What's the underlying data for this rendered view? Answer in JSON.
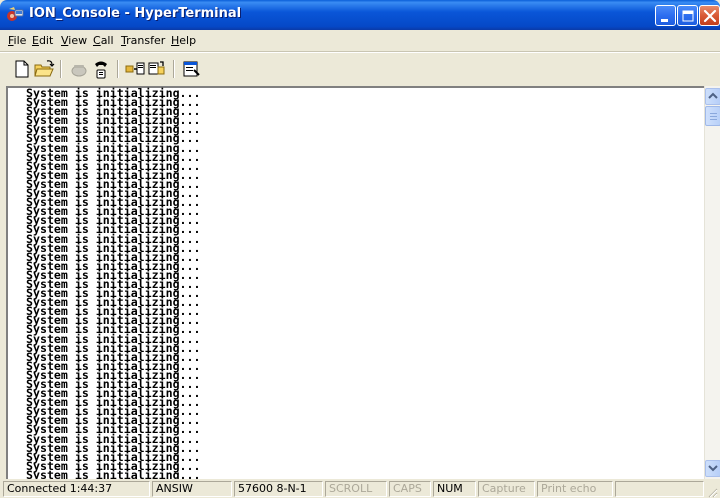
{
  "window": {
    "title": "ION_Console - HyperTerminal",
    "icon": "hyperterminal-phone-icon",
    "controls": [
      "minimize-icon",
      "maximize-icon",
      "close-icon"
    ]
  },
  "menu": {
    "items": [
      {
        "label": "File"
      },
      {
        "label": "Edit"
      },
      {
        "label": "View"
      },
      {
        "label": "Call"
      },
      {
        "label": "Transfer"
      },
      {
        "label": "Help"
      }
    ]
  },
  "toolbar": {
    "buttons": [
      {
        "icon": "new-document-icon"
      },
      {
        "icon": "open-folder-icon"
      },
      {
        "icon": "connect-phone-icon"
      },
      {
        "icon": "disconnect-phone-icon"
      },
      {
        "icon": "send-file-icon"
      },
      {
        "icon": "receive-file-icon"
      },
      {
        "icon": "properties-icon"
      }
    ]
  },
  "terminal": {
    "lines": [
      "System is initializing...",
      "System is initializing...",
      "System is initializing...",
      "System is initializing...",
      "System is initializing...",
      "System is initializing...",
      "System is initializing...",
      "System is initializing...",
      "System is initializing...",
      "System is initializing...",
      "System is initializing...",
      "System is initializing...",
      "System is initializing...",
      "System is initializing...",
      "System is initializing...",
      "System is initializing...",
      "System is initializing...",
      "System is initializing...",
      "System is initializing...",
      "System is initializing...",
      "System is initializing...",
      "System is initializing...",
      "System is initializing...",
      "System is initializing...",
      "System is initializing...",
      "System is initializing...",
      "System is initializing...",
      "System is initializing...",
      "System is initializing...",
      "System is initializing...",
      "System is initializing...",
      "System is initializing...",
      "System is initializing...",
      "System is initializing...",
      "System is initializing...",
      "System is initializing...",
      "System is initializing...",
      "System is initializing...",
      "System is initializing...",
      "System is initializing...",
      "System is initializing...",
      "System is initializing...",
      "System is initializing..."
    ]
  },
  "status": {
    "connected": "Connected 1:44:37",
    "emulation": "ANSIW",
    "port_settings": "57600 8-N-1",
    "scroll": "SCROLL",
    "caps": "CAPS",
    "num": "NUM",
    "capture": "Capture",
    "print_echo": "Print echo"
  },
  "colors": {
    "titlebar": "#0a56d8",
    "close_button": "#d95a36",
    "terminal_bg": "#ffffff",
    "chrome": "#ece9d8"
  }
}
